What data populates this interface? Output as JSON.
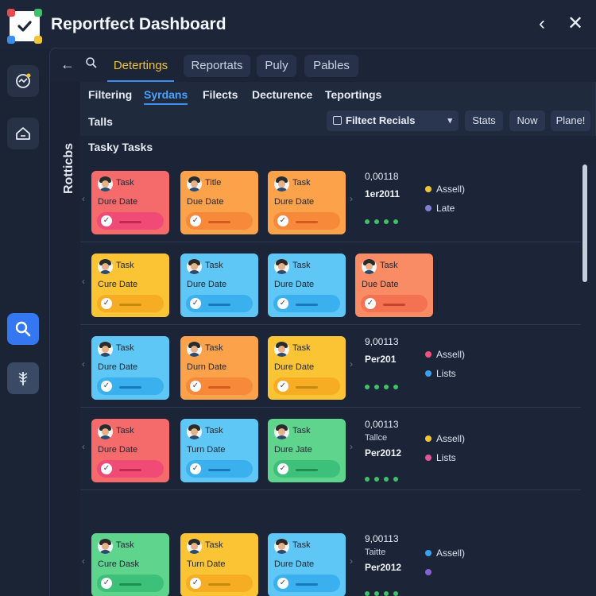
{
  "app": {
    "title": "Reportfect Dashboard"
  },
  "topnav": {
    "tabs": [
      "Detertings",
      "Reportats",
      "Puly",
      "Pables"
    ]
  },
  "vertical_tab": "Rotticbs",
  "subtabs": [
    "Filtering",
    "Syrdans",
    "Filects",
    "Decturence",
    "Teportings"
  ],
  "filterbar": {
    "label": "Talls",
    "select_value": "Filtect Recials",
    "buttons": [
      "Stats",
      "Now",
      "Plane!"
    ]
  },
  "board": {
    "title": "Tasky Tasks"
  },
  "rows": [
    {
      "cards": [
        {
          "color": "red",
          "title": "Task",
          "date": "Dure Date"
        },
        {
          "color": "orange",
          "title": "Title",
          "date": "Due Date"
        },
        {
          "color": "orange",
          "title": "Task",
          "date": "Dure Date"
        }
      ],
      "stat_num": "0,00118",
      "stat_sub": "",
      "stat_per": "1er2011",
      "legend": [
        {
          "label": "Assell)",
          "color": "#f2c534"
        },
        {
          "label": "Late",
          "color": "#7b7fd6"
        }
      ]
    },
    {
      "cards": [
        {
          "color": "yellow",
          "title": "Task",
          "date": "Cure Date"
        },
        {
          "color": "blue",
          "title": "Task",
          "date": "Dure Date"
        },
        {
          "color": "blue",
          "title": "Task",
          "date": "Dure Date"
        },
        {
          "color": "coral",
          "title": "Task",
          "date": "Due Date"
        }
      ]
    },
    {
      "cards": [
        {
          "color": "blue",
          "title": "Task",
          "date": "Dure Date"
        },
        {
          "color": "orange",
          "title": "Task",
          "date": "Durn Date"
        },
        {
          "color": "yellow",
          "title": "Task",
          "date": "Dure Date"
        }
      ],
      "stat_num": "9,00113",
      "stat_sub": "",
      "stat_per": "Per201",
      "legend": [
        {
          "label": "Assell)",
          "color": "#f0507a"
        },
        {
          "label": "Lists",
          "color": "#3aa0f0"
        }
      ]
    },
    {
      "cards": [
        {
          "color": "red",
          "title": "Task",
          "date": "Dure Date"
        },
        {
          "color": "blue",
          "title": "Task",
          "date": "Turn Date"
        },
        {
          "color": "green",
          "title": "Task",
          "date": "Dure Jate"
        }
      ],
      "stat_num": "0,00113",
      "stat_sub": "Tallce",
      "stat_per": "Per2012",
      "legend": [
        {
          "label": "Assell)",
          "color": "#f2c534"
        },
        {
          "label": "Lists",
          "color": "#e0559b"
        }
      ]
    },
    {
      "cards": [
        {
          "color": "green",
          "title": "Task",
          "date": "Cure Dask"
        },
        {
          "color": "yellow",
          "title": "Task",
          "date": "Turn Date"
        },
        {
          "color": "blue",
          "title": "Task",
          "date": "Dure Date"
        }
      ],
      "stat_num": "9,00113",
      "stat_sub": "Taitte",
      "stat_per": "Per2012",
      "legend": [
        {
          "label": "Assell)",
          "color": "#3aa0f0"
        },
        {
          "label": "",
          "color": "#8a5fd0"
        }
      ]
    }
  ]
}
